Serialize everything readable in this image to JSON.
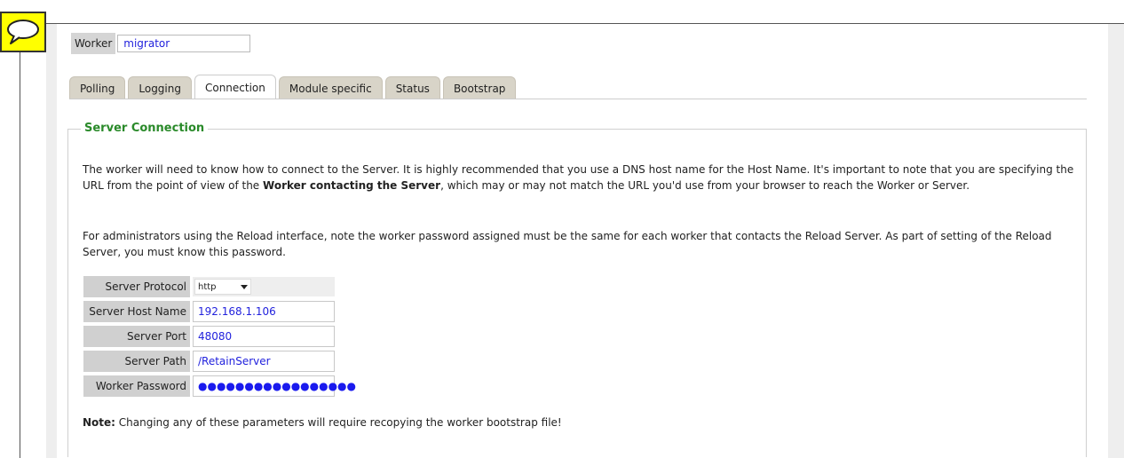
{
  "worker": {
    "label": "Worker",
    "value": "migrator"
  },
  "tabs": [
    {
      "label": "Polling",
      "active": false
    },
    {
      "label": "Logging",
      "active": false
    },
    {
      "label": "Connection",
      "active": true
    },
    {
      "label": "Module specific",
      "active": false
    },
    {
      "label": "Status",
      "active": false
    },
    {
      "label": "Bootstrap",
      "active": false
    }
  ],
  "section": {
    "title": "Server Connection",
    "p1_before": "The worker will need to know how to connect to the Server. It is highly recommended that you use a DNS host name for the Host Name. It's important to note that you are specifying the URL from the point of view of the ",
    "p1_bold": "Worker contacting the Server",
    "p1_after": ", which may or may not match the URL you'd use from your browser to reach the Worker or Server.",
    "p2": "For administrators using the Reload interface, note the worker password assigned must be the same for each worker that contacts the Reload Server. As part of setting of the Reload Server, you must know this password."
  },
  "form": {
    "protocol_label": "Server Protocol",
    "protocol_value": "http",
    "host_label": "Server Host Name",
    "host_value": "192.168.1.106",
    "port_label": "Server Port",
    "port_value": "48080",
    "path_label": "Server Path",
    "path_value": "/RetainServer",
    "password_label": "Worker Password",
    "password_value": "●●●●●●●●●●●●●●●●●"
  },
  "note": {
    "bold": "Note:",
    "text": " Changing any of these parameters will require recopying the worker bootstrap file!"
  },
  "colors": {
    "accent_green": "#2a8a2a",
    "input_text": "#2222dd",
    "callout_yellow": "#ffff00"
  },
  "icons": {
    "callout": "speech-bubble-icon",
    "dropdown": "chevron-down-icon"
  }
}
